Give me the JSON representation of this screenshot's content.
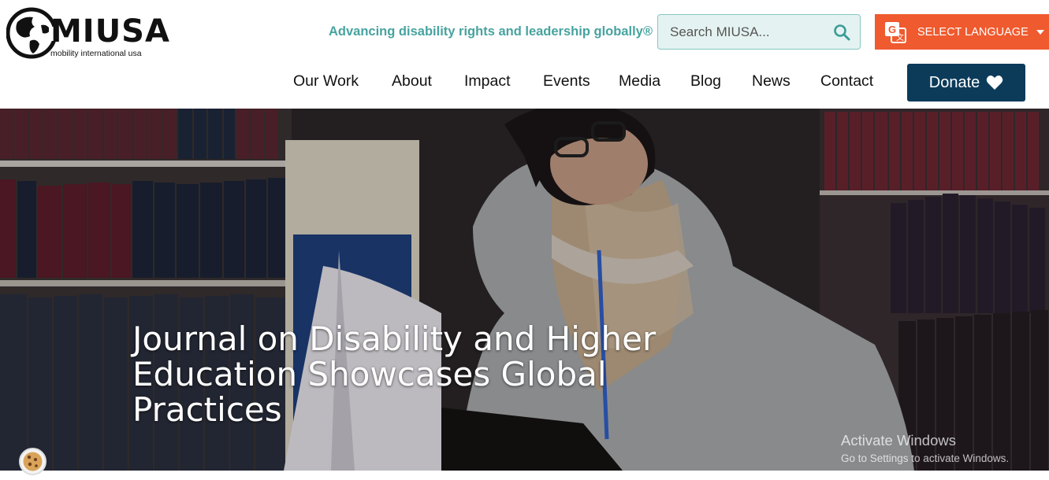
{
  "logo": {
    "name": "MIUSA",
    "subtitle": "mobility international usa"
  },
  "header": {
    "tagline": "Advancing disability rights and leadership globally®",
    "search": {
      "placeholder": "Search MIUSA..."
    },
    "language": {
      "label": "SELECT LANGUAGE"
    }
  },
  "nav": {
    "items": [
      {
        "label": "Our Work"
      },
      {
        "label": "About"
      },
      {
        "label": "Impact"
      },
      {
        "label": "Events"
      },
      {
        "label": "Media"
      },
      {
        "label": "Blog"
      },
      {
        "label": "News"
      },
      {
        "label": "Contact"
      }
    ],
    "donate_label": "Donate"
  },
  "hero": {
    "title": "Journal on Disability and Higher Education Showcases Global Practices"
  },
  "os_watermark": {
    "title": "Activate Windows",
    "subtitle": "Go to Settings to activate Windows."
  },
  "colors": {
    "accent_teal": "#47a39f",
    "language_orange": "#ef5a2e",
    "donate_navy": "#0c3b5a"
  }
}
